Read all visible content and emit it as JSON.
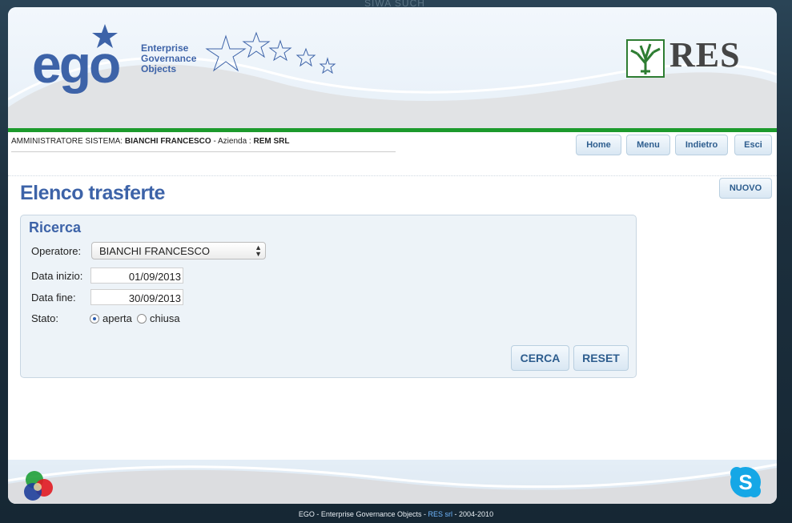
{
  "background": {
    "text": "SIWA SUCH"
  },
  "brand": {
    "logo_text": "ego",
    "tagline_lines": [
      "Enterprise",
      "Governance",
      "Objects"
    ],
    "partner_logo_text": "RES",
    "primary_color": "#3d63a8",
    "accent_color": "#1c9a2c"
  },
  "user_bar": {
    "role": "AMMINISTRATORE SISTEMA:",
    "name": "BIANCHI FRANCESCO",
    "company_label": "- Azienda :",
    "company": "REM SRL"
  },
  "nav": {
    "home": "Home",
    "menu": "Menu",
    "back": "Indietro",
    "exit": "Esci"
  },
  "page": {
    "title": "Elenco trasferte",
    "new_label": "NUOVO"
  },
  "search": {
    "title": "Ricerca",
    "operator_label": "Operatore:",
    "operator_value": "BIANCHI FRANCESCO",
    "start_label": "Data inizio:",
    "start_value": "01/09/2013",
    "end_label": "Data fine:",
    "end_value": "30/09/2013",
    "status_label": "Stato:",
    "status_options": [
      "aperta",
      "chiusa"
    ],
    "status_selected": "aperta",
    "search_button": "CERCA",
    "reset_button": "RESET"
  },
  "footer": {
    "copyright_prefix": "EGO - Enterprise Governance Objects -",
    "copyright_link": "RES srl",
    "copyright_suffix": "- 2004-2010"
  },
  "icons": {
    "color_wheel": "rgb-circles-icon",
    "skype": "skype-icon",
    "select_arrows": "updown-arrows-icon"
  }
}
